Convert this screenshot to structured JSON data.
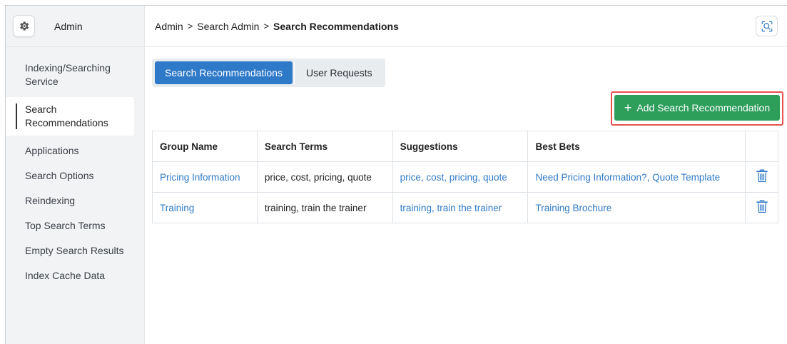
{
  "brand": {
    "label": "Admin",
    "icon": "gear-icon"
  },
  "sidebar": {
    "items": [
      {
        "label": "Indexing/Searching Service",
        "active": false
      },
      {
        "label": "Search Recommendations",
        "active": true
      },
      {
        "label": "Applications",
        "active": false
      },
      {
        "label": "Search Options",
        "active": false
      },
      {
        "label": "Reindexing",
        "active": false
      },
      {
        "label": "Top Search Terms",
        "active": false
      },
      {
        "label": "Empty Search Results",
        "active": false
      },
      {
        "label": "Index Cache Data",
        "active": false
      }
    ]
  },
  "breadcrumb": {
    "items": [
      "Admin",
      "Search Admin"
    ],
    "separator": ">",
    "current": "Search Recommendations"
  },
  "header": {
    "search_icon": "search-icon"
  },
  "tabs": [
    {
      "label": "Search Recommendations",
      "active": true
    },
    {
      "label": "User Requests",
      "active": false
    }
  ],
  "toolbar": {
    "add_label": "Add Search Recommendation",
    "add_icon": "+"
  },
  "table": {
    "headers": [
      "Group Name",
      "Search Terms",
      "Suggestions",
      "Best Bets",
      ""
    ],
    "rows": [
      {
        "group_name": "Pricing Information",
        "search_terms": "price, cost, pricing, quote",
        "suggestions": "price, cost, pricing, quote",
        "best_bets": "Need Pricing Information?, Quote Template"
      },
      {
        "group_name": "Training",
        "search_terms": "training, train the trainer",
        "suggestions": "training, train the trainer",
        "best_bets": "Training Brochure"
      }
    ]
  },
  "colors": {
    "accent_blue": "#2f7ac8",
    "add_green": "#2e9e5b",
    "highlight_red": "#e5534b"
  }
}
